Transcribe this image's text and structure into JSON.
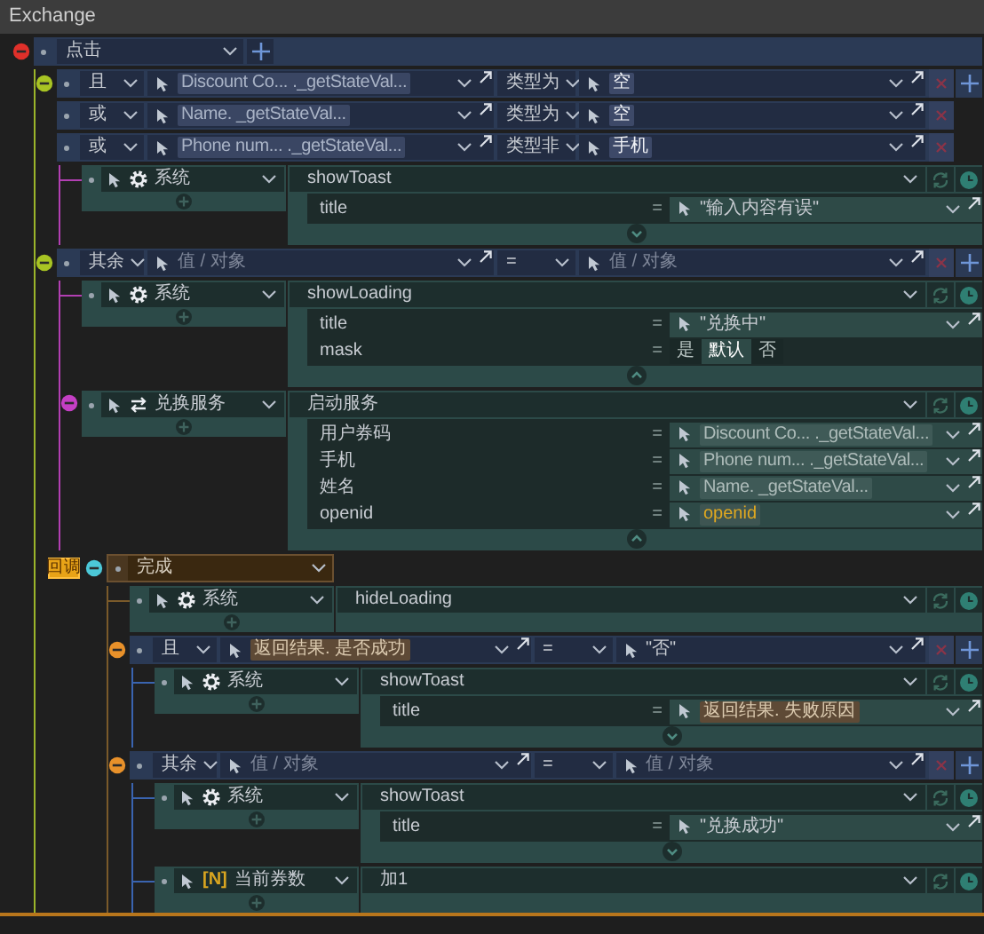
{
  "window": {
    "title": "Exchange"
  },
  "event": {
    "label": "点击",
    "branches": [
      {
        "conditions": [
          {
            "op": "且",
            "subject": {
              "kind": "state",
              "text": "Discount Co... ._getStateVal..."
            },
            "compare": "类型为",
            "value": {
              "kind": "constant",
              "text": "空"
            }
          },
          {
            "op": "或",
            "subject": {
              "kind": "state",
              "text": "Name. _getStateVal..."
            },
            "compare": "类型为",
            "value": {
              "kind": "constant",
              "text": "空"
            }
          },
          {
            "op": "或",
            "subject": {
              "kind": "state",
              "text": "Phone num... ._getStateVal..."
            },
            "compare": "类型非",
            "value": {
              "kind": "constant",
              "text": "手机"
            }
          }
        ],
        "actions": [
          {
            "kind": "system",
            "target": "系统",
            "method": "showToast",
            "expanded": false,
            "params": [
              {
                "name": "title",
                "operator": "=",
                "value": {
                  "kind": "literal",
                  "text": "\"输入内容有误\""
                }
              }
            ]
          }
        ]
      },
      {
        "conditions": [
          {
            "op": "其余",
            "subject": {
              "placeholder": "值 / 对象"
            },
            "compare": "=",
            "value": {
              "placeholder": "值 / 对象"
            }
          }
        ],
        "actions": [
          {
            "kind": "system",
            "target": "系统",
            "method": "showLoading",
            "expanded": true,
            "params": [
              {
                "name": "title",
                "operator": "=",
                "value": {
                  "kind": "literal",
                  "text": "\"兑换中\""
                }
              },
              {
                "name": "mask",
                "operator": "=",
                "kind": "choice",
                "options": [
                  {
                    "label": "是",
                    "selected": false
                  },
                  {
                    "label": "默认",
                    "selected": true
                  },
                  {
                    "label": "否",
                    "selected": false
                  }
                ]
              }
            ]
          },
          {
            "kind": "service",
            "target": "兑换服务",
            "method": "启动服务",
            "expanded": true,
            "params": [
              {
                "name": "用户券码",
                "operator": "=",
                "value": {
                  "kind": "state",
                  "text": "Discount Co... ._getStateVal..."
                }
              },
              {
                "name": "手机",
                "operator": "=",
                "value": {
                  "kind": "state",
                  "text": "Phone num... ._getStateVal..."
                }
              },
              {
                "name": "姓名",
                "operator": "=",
                "value": {
                  "kind": "state",
                  "text": "Name. _getStateVal..."
                }
              },
              {
                "name": "openid",
                "operator": "=",
                "value": {
                  "kind": "variable",
                  "text": "openid"
                }
              }
            ],
            "callback": {
              "badge": "回调",
              "label": "完成",
              "actions": [
                {
                  "kind": "system",
                  "target": "系统",
                  "method": "hideLoading"
                }
              ],
              "branches": [
                {
                  "conditions": [
                    {
                      "op": "且",
                      "subject": {
                        "kind": "result",
                        "text": "返回结果. 是否成功"
                      },
                      "compare": "=",
                      "value": {
                        "kind": "literal",
                        "text": "\"否\""
                      }
                    }
                  ],
                  "actions": [
                    {
                      "kind": "system",
                      "target": "系统",
                      "method": "showToast",
                      "expanded": false,
                      "params": [
                        {
                          "name": "title",
                          "operator": "=",
                          "value": {
                            "kind": "result",
                            "text": "返回结果. 失败原因"
                          }
                        }
                      ]
                    }
                  ]
                },
                {
                  "conditions": [
                    {
                      "op": "其余",
                      "subject": {
                        "placeholder": "值 / 对象"
                      },
                      "compare": "=",
                      "value": {
                        "placeholder": "值 / 对象"
                      }
                    }
                  ],
                  "actions": [
                    {
                      "kind": "system",
                      "target": "系统",
                      "method": "showToast",
                      "expanded": false,
                      "params": [
                        {
                          "name": "title",
                          "operator": "=",
                          "value": {
                            "kind": "literal",
                            "text": "\"兑换成功\""
                          }
                        }
                      ]
                    },
                    {
                      "kind": "variable",
                      "badge": "[N]",
                      "target": "当前券数",
                      "method": "加1"
                    }
                  ]
                }
              ]
            }
          }
        ]
      }
    ]
  }
}
